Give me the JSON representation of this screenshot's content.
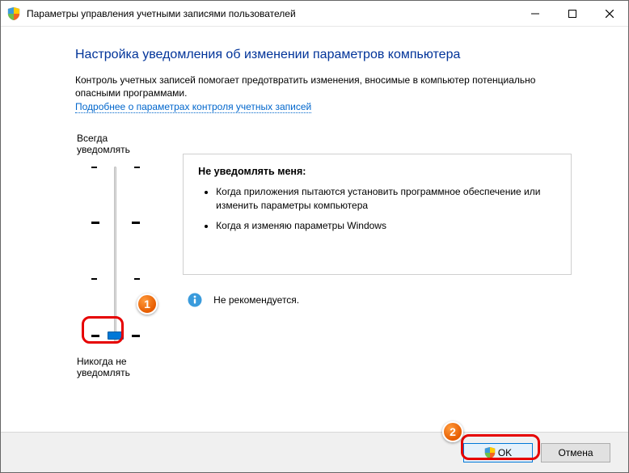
{
  "window": {
    "title": "Параметры управления учетными записями пользователей"
  },
  "heading": "Настройка уведомления об изменении параметров компьютера",
  "description": "Контроль учетных записей помогает предотвратить изменения, вносимые в компьютер потенциально опасными программами.",
  "link_text": "Подробнее о параметрах контроля учетных записей",
  "slider": {
    "top_label": "Всегда уведомлять",
    "bottom_label": "Никогда не уведомлять"
  },
  "info": {
    "title": "Не уведомлять меня:",
    "bullets": [
      "Когда приложения пытаются установить программное обеспечение или изменить параметры компьютера",
      "Когда я изменяю параметры Windows"
    ],
    "recommendation": "Не рекомендуется."
  },
  "buttons": {
    "ok": "OK",
    "cancel": "Отмена"
  },
  "callouts": {
    "1": "1",
    "2": "2"
  }
}
